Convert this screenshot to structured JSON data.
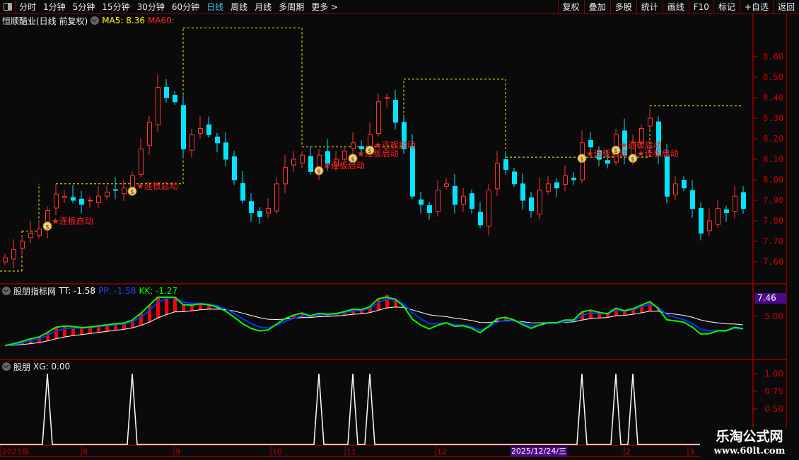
{
  "toolbar": {
    "periods": [
      "分时",
      "1分钟",
      "5分钟",
      "15分钟",
      "30分钟",
      "60分钟",
      "日线",
      "周线",
      "月线",
      "多周期",
      "更多 >"
    ],
    "active": "日线",
    "right_buttons": [
      "复权",
      "叠加",
      "多股",
      "统计",
      "画线",
      "F10",
      "标记",
      "+自选",
      "返回"
    ]
  },
  "title": {
    "stock": "恒顺醋业(日线 前复权)",
    "ma5": "MA5: 8.36",
    "ma60": "MA60:"
  },
  "indicator": {
    "name": "股朋指标网",
    "tt": "TT: -1.58",
    "pp": "PP: -1.58",
    "kk": "KK: -1.27",
    "axis_label": "5.00",
    "current": "7.46"
  },
  "xg_panel": {
    "name": "股朋",
    "xg": "XG: 0.00",
    "ticks": [
      "1.00",
      "0.75",
      "0.50"
    ]
  },
  "dates": {
    "labels": [
      "2025年",
      "8",
      "9",
      "10",
      "11",
      "12",
      "2",
      "3"
    ],
    "highlight": "2025/12/24/三"
  },
  "watermark": {
    "line1": "乐淘公式网",
    "line2": "www.60lt.com"
  },
  "signal_label": "连板启动",
  "colors": {
    "up": "#ff3333",
    "down": "#00e5ff",
    "step": "#ffff00",
    "tt": "#ffffff",
    "pp": "#0033ff",
    "kk": "#00ff00",
    "axis": "#cc0000"
  },
  "chart_data": {
    "type": "candlestick",
    "y_ticks": [
      8.6,
      8.5,
      8.4,
      8.3,
      8.2,
      8.1,
      8.0,
      7.9,
      7.8,
      7.7,
      7.6
    ],
    "ylim": [
      7.53,
      8.78
    ],
    "closes": [
      7.62,
      7.66,
      7.7,
      7.74,
      7.76,
      7.85,
      7.93,
      7.92,
      7.9,
      7.88,
      7.9,
      7.92,
      7.94,
      7.95,
      7.96,
      8.02,
      8.15,
      8.28,
      8.45,
      8.4,
      8.38,
      8.15,
      8.22,
      8.25,
      8.22,
      8.18,
      8.1,
      8.0,
      7.9,
      7.84,
      7.82,
      7.86,
      7.98,
      8.06,
      8.1,
      8.12,
      8.04,
      8.12,
      8.08,
      8.1,
      8.14,
      8.18,
      8.15,
      8.22,
      8.38,
      8.4,
      8.28,
      8.15,
      7.92,
      7.88,
      7.84,
      7.95,
      7.98,
      7.88,
      7.92,
      7.86,
      7.78,
      7.95,
      8.08,
      8.05,
      7.98,
      7.9,
      7.85,
      7.95,
      7.98,
      7.96,
      8.02,
      8.0,
      8.18,
      8.16,
      8.1,
      8.08,
      8.22,
      8.12,
      8.18,
      8.25,
      8.3,
      8.12,
      7.92,
      7.98,
      7.96,
      7.86,
      7.74,
      7.8,
      7.86,
      7.84,
      7.92,
      7.86
    ],
    "signal_indices": [
      5,
      15,
      37,
      41,
      43,
      68,
      72,
      74
    ],
    "step_levels": [
      {
        "from": 0,
        "to": 2,
        "price": 7.555
      },
      {
        "from": 2,
        "to": 4,
        "price": 7.75
      },
      {
        "from": 6,
        "to": 21,
        "price": 7.98
      },
      {
        "from": 21,
        "to": 35,
        "price": 8.74
      },
      {
        "from": 35,
        "to": 47,
        "price": 8.16
      },
      {
        "from": 47,
        "to": 59,
        "price": 8.49
      },
      {
        "from": 59,
        "to": 76,
        "price": 8.11
      },
      {
        "from": 76,
        "to": 87,
        "price": 8.36
      }
    ]
  }
}
